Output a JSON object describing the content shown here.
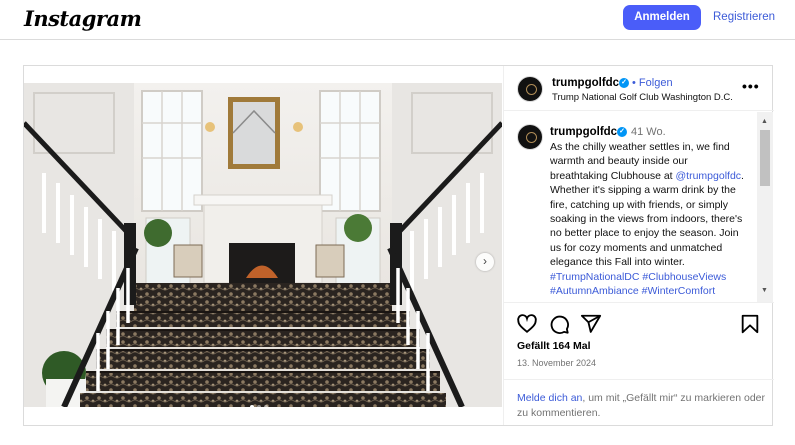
{
  "header": {
    "logo": "Instagram",
    "login_label": "Anmelden",
    "register_label": "Registrieren"
  },
  "post": {
    "account": {
      "username": "trumpgolfdc",
      "follow_label": "Folgen",
      "subtitle": "Trump National Golf Club Washington D.C.",
      "more_label": "•••"
    },
    "caption": {
      "username": "trumpgolfdc",
      "age": "41 Wo.",
      "text_part1": "As the chilly weather settles in, we find warmth and beauty inside our breathtaking Clubhouse at ",
      "mention": "@trumpgolfdc",
      "text_part2": ". Whether it's sipping a warm drink by the fire, catching up with friends, or simply soaking in the views from indoors, there's no better place to enjoy the season. Join us for cozy moments and unmatched elegance this Fall into winter.",
      "hashtags": "#TrumpNationalDC #ClubhouseViews",
      "hashtags_cut": "#AutumnAmbiance #WinterComfort"
    },
    "likes": "Gefällt 164 Mal",
    "date": "13. November 2024",
    "login_prompt": {
      "link": "Melde dich an",
      "text": ", um mit „Gefällt mir“ zu markieren oder zu kommentieren."
    },
    "icons": [
      "heart-icon",
      "comment-icon",
      "share-icon",
      "bookmark-icon",
      "verified-badge-icon",
      "more-options-icon",
      "next-image-icon"
    ],
    "carousel": {
      "dot_count": 3,
      "active_index": 0
    }
  },
  "colors": {
    "accent": "#4a5df9",
    "link": "#3c5bd8",
    "verified": "#0095f6",
    "muted": "#737373"
  }
}
